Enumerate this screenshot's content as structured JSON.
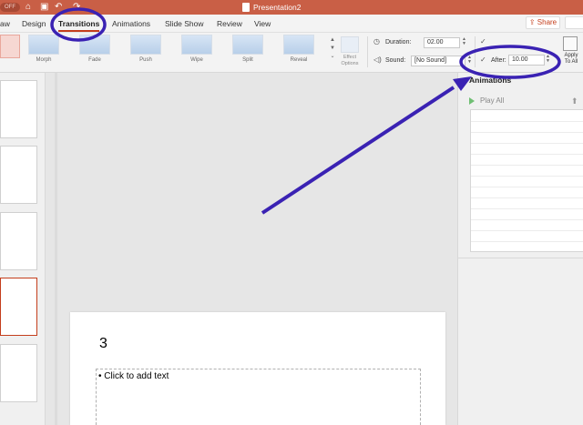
{
  "titlebar": {
    "autosave": "OFF",
    "title": "Presentation2",
    "bg_color": "#c95f46"
  },
  "tabs": {
    "items": [
      "aw",
      "Design",
      "Transitions",
      "Animations",
      "Slide Show",
      "Review",
      "View"
    ],
    "active": "Transitions",
    "share_label": "Share"
  },
  "ribbon": {
    "gallery": [
      "Morph",
      "Fade",
      "Push",
      "Wipe",
      "Split",
      "Reveal"
    ],
    "effect_options": [
      "Effect",
      "Options"
    ],
    "duration_label": "Duration:",
    "duration_value": "02.00",
    "sound_label": "Sound:",
    "sound_value": "[No Sound]",
    "after_label": "After:",
    "after_value": "10.00",
    "after_checked": true,
    "apply": [
      "Apply",
      "To All"
    ]
  },
  "animations_pane": {
    "title": "Animations",
    "play_all": "Play All"
  },
  "slide": {
    "title": "3",
    "body": "• Click to add text"
  },
  "annotation_color": "#3a22b3",
  "icons": [
    "home-icon",
    "save-icon",
    "undo-icon",
    "redo-icon",
    "clock-icon",
    "sound-icon",
    "checkbox-icon",
    "play-icon",
    "up-arrow-icon",
    "comment-icon",
    "document-icon",
    "apply-all-icon"
  ]
}
